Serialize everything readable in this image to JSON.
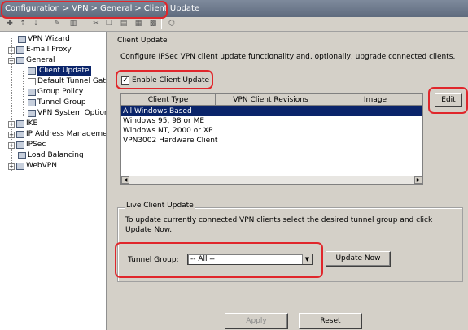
{
  "breadcrumb": {
    "items": [
      "Configuration",
      "VPN",
      "General",
      "Client Update"
    ],
    "separator": ">"
  },
  "toolbar": {
    "icons": [
      "add-icon",
      "move-up-icon",
      "move-down-icon",
      "edit-icon",
      "delete-icon",
      "cut-icon",
      "copy-icon",
      "paste-icon",
      "paste-after-icon",
      "find-icon"
    ]
  },
  "tree": {
    "items": [
      {
        "label": "VPN Wizard",
        "icon": "wizard-icon"
      },
      {
        "label": "E-mail Proxy",
        "icon": "folder-icon"
      },
      {
        "label": "General",
        "icon": "folder-icon"
      },
      {
        "label": "Client Update",
        "icon": "page-icon"
      },
      {
        "label": "Default Tunnel Gate",
        "icon": "arrow-icon"
      },
      {
        "label": "Group Policy",
        "icon": "group-icon"
      },
      {
        "label": "Tunnel Group",
        "icon": "tunnel-icon"
      },
      {
        "label": "VPN System Option",
        "icon": "system-icon"
      },
      {
        "label": "IKE",
        "icon": "ike-icon"
      },
      {
        "label": "IP Address Manageme",
        "icon": "address-icon"
      },
      {
        "label": "IPSec",
        "icon": "ipsec-icon"
      },
      {
        "label": "Load Balancing",
        "icon": "balance-icon"
      },
      {
        "label": "WebVPN",
        "icon": "webvpn-icon"
      }
    ]
  },
  "client_update": {
    "section_title": "Client Update",
    "description": "Configure IPSec VPN client update functionality and, optionally, upgrade connected clients.",
    "enable_label": "Enable Client Update",
    "enable_checked": "✓",
    "table": {
      "columns": [
        "Client Type",
        "VPN Client Revisions",
        "Image"
      ],
      "rows": [
        "All Windows Based",
        "Windows 95, 98 or ME",
        "Windows NT, 2000 or XP",
        "VPN3002 Hardware Client"
      ]
    },
    "edit_label": "Edit"
  },
  "live_update": {
    "title": "Live Client Update",
    "description": "To update currently connected VPN clients select the desired tunnel group and click Update Now.",
    "tunnel_group_label": "Tunnel Group:",
    "tunnel_group_value": "-- All --",
    "update_now_label": "Update Now"
  },
  "footer": {
    "apply_label": "Apply",
    "reset_label": "Reset"
  },
  "colors": {
    "highlight": "#e0262b",
    "selection": "#0a246a",
    "panel": "#d4d0c8"
  }
}
